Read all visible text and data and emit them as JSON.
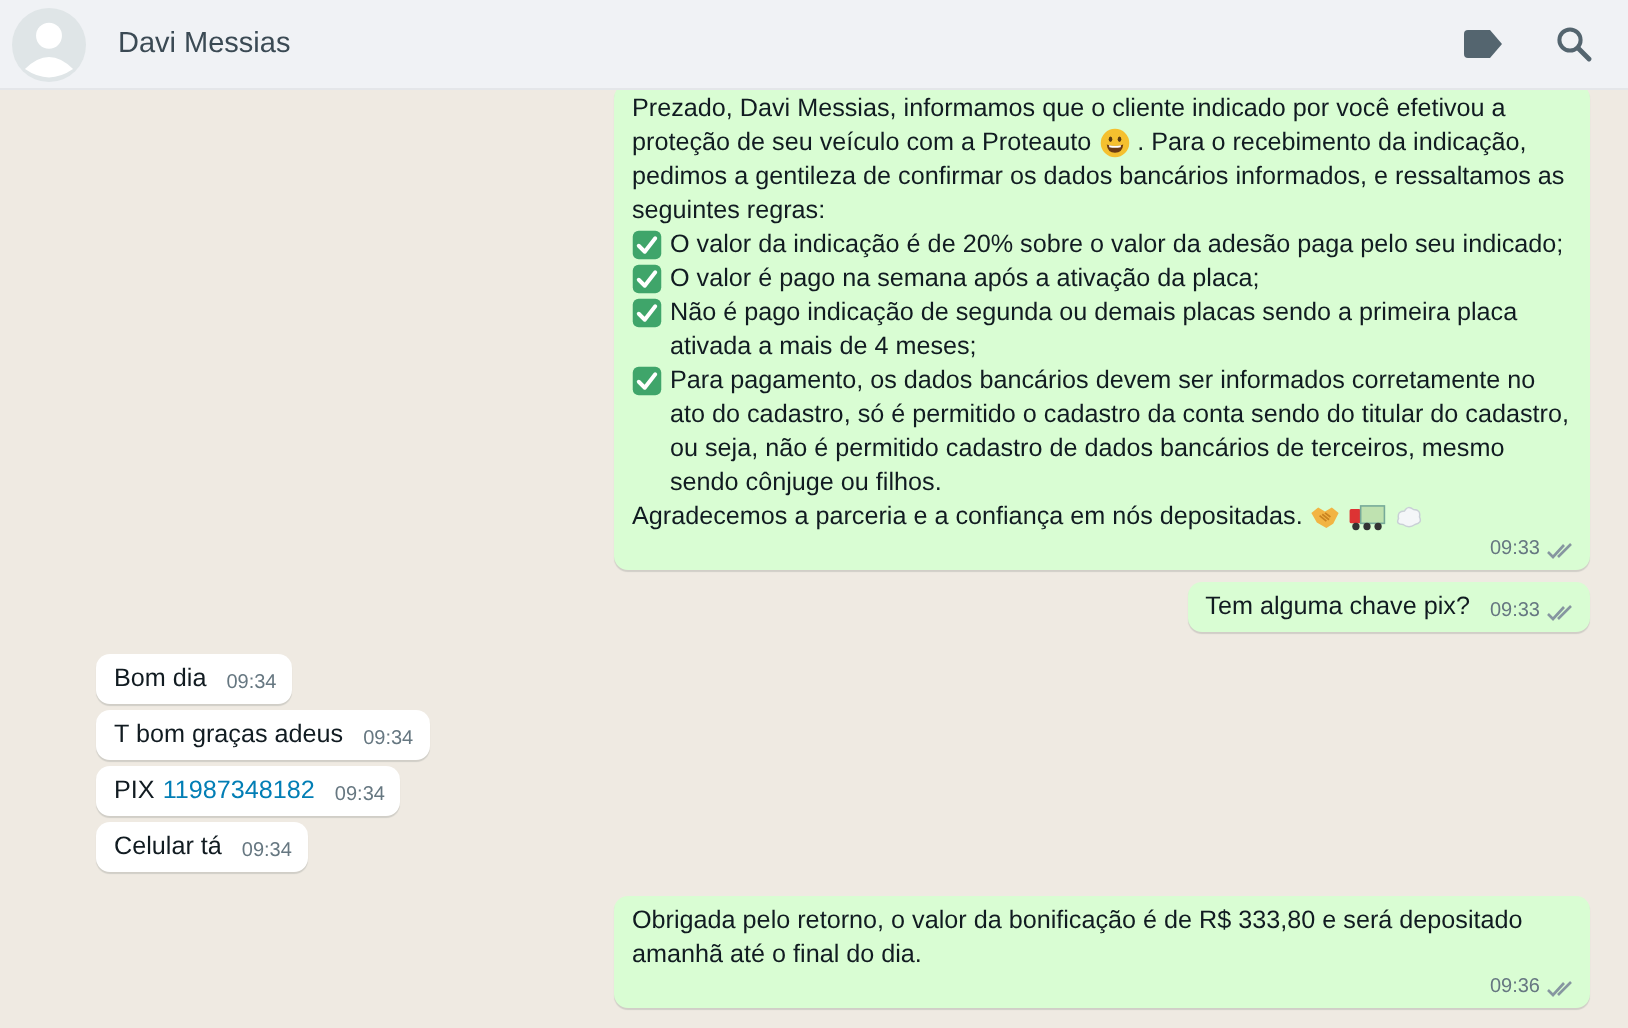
{
  "header": {
    "contact_name": "Davi Messias"
  },
  "messages": [
    {
      "kind": "outgoing",
      "time": "09:33",
      "blocks": [
        [
          {
            "kind": "text",
            "text": "Prezado, Davi Messias, informamos que o cliente indicado por você efetivou a"
          }
        ],
        [
          {
            "kind": "text",
            "text": "proteção de seu veículo com a Proteauto"
          },
          {
            "kind": "smile"
          },
          {
            "kind": "text",
            "text": ". Para o recebimento da indicação,"
          }
        ],
        [
          {
            "kind": "text",
            "text": "pedimos a gentileza de confirmar os dados bancários informados, e  ressaltamos as seguintes regras:"
          }
        ],
        [
          {
            "kind": "check"
          },
          {
            "kind": "text",
            "text": "O valor da indicação é de 20% sobre o valor da adesão paga pelo seu indicado;"
          }
        ],
        [
          {
            "kind": "check"
          },
          {
            "kind": "text",
            "text": "O valor é pago na semana após a ativação da placa;"
          }
        ],
        [
          {
            "kind": "check"
          },
          {
            "kind": "text",
            "text": "Não é pago indicação de segunda ou demais placas sendo a primeira placa ativada a mais de 4 meses;"
          }
        ],
        [
          {
            "kind": "check"
          },
          {
            "kind": "text",
            "text": "Para pagamento, os dados bancários devem ser informados corretamente no ato do cadastro, só é permitido o cadastro da conta sendo do titular do cadastro, ou seja, não é permitido cadastro de dados bancários de terceiros, mesmo sendo cônjuge ou filhos."
          }
        ],
        [
          {
            "kind": "text",
            "text": "Agradecemos a parceria e a confiança em nós depositadas."
          },
          {
            "kind": "handshake"
          },
          {
            "kind": "truck"
          },
          {
            "kind": "cloud"
          }
        ]
      ]
    },
    {
      "kind": "outgoing",
      "time": "09:33",
      "blocks": [
        [
          {
            "kind": "text",
            "text": "Tem alguma chave pix?"
          }
        ]
      ]
    },
    {
      "kind": "incoming",
      "time": "09:34",
      "blocks": [
        [
          {
            "kind": "text",
            "text": "Bom dia"
          }
        ]
      ]
    },
    {
      "kind": "incoming",
      "time": "09:34",
      "blocks": [
        [
          {
            "kind": "text",
            "text": "T bom graças adeus"
          }
        ]
      ]
    },
    {
      "kind": "incoming",
      "time": "09:34",
      "blocks": [
        [
          {
            "kind": "text",
            "text": "PIX"
          },
          {
            "kind": "link",
            "text": "11987348182"
          }
        ]
      ]
    },
    {
      "kind": "incoming",
      "time": "09:34",
      "blocks": [
        [
          {
            "kind": "text",
            "text": "Celular tá"
          }
        ]
      ]
    },
    {
      "kind": "outgoing",
      "time": "09:36",
      "blocks": [
        [
          {
            "kind": "text",
            "text": "Obrigada pelo retorno, o valor da bonificação é de R$ 333,80 e será depositado amanhã até o final do dia."
          }
        ]
      ]
    }
  ]
}
